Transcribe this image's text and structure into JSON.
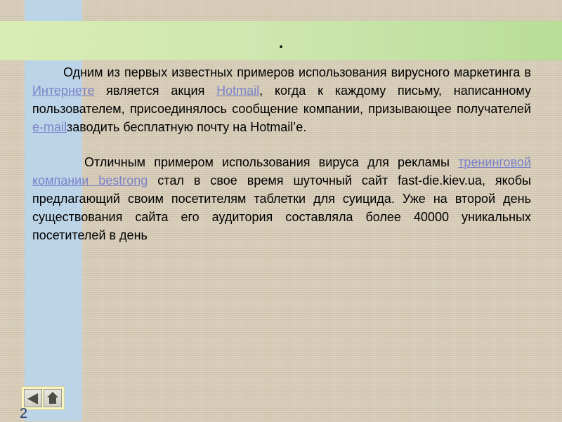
{
  "slide": {
    "title": ".",
    "paragraphs": [
      {
        "parts": [
          {
            "text": "Одним из первых известных примеров использования вирусного маркетинга в ",
            "link": false
          },
          {
            "text": "Интернете",
            "link": true
          },
          {
            "text": " является акция ",
            "link": false
          },
          {
            "text": "Hotmail",
            "link": true
          },
          {
            "text": ", когда к каждому письму, написанному пользователем, присоединялось сообщение компании, призывающее получателей ",
            "link": false
          },
          {
            "text": "e-mail",
            "link": true
          },
          {
            "text": "заводить бесплатную почту на Hotmail’е.",
            "link": false
          }
        ]
      },
      {
        "parts": [
          {
            "text": "Отличным примером использования вируса для рекламы ",
            "link": false
          },
          {
            "text": "тренинговой компании bestrong",
            "link": true
          },
          {
            "text": " стал в свое время шуточный сайт fast-die.kiev.ua, якобы предлагающий своим посетителям таблетки для суицида. Уже на второй день существования сайта его аудитория составляла более 40000 уникальных посетителей в день",
            "link": false
          }
        ]
      }
    ],
    "page_number": "2"
  },
  "nav": {
    "back_icon": "triangle-left-icon",
    "home_icon": "home-icon"
  },
  "colors": {
    "background": "#d7cdb8",
    "left_strip": "#bcd4e8",
    "title_band": "#cfe7b0",
    "link": "#7a82c8",
    "page_number": "#1f3a78"
  }
}
